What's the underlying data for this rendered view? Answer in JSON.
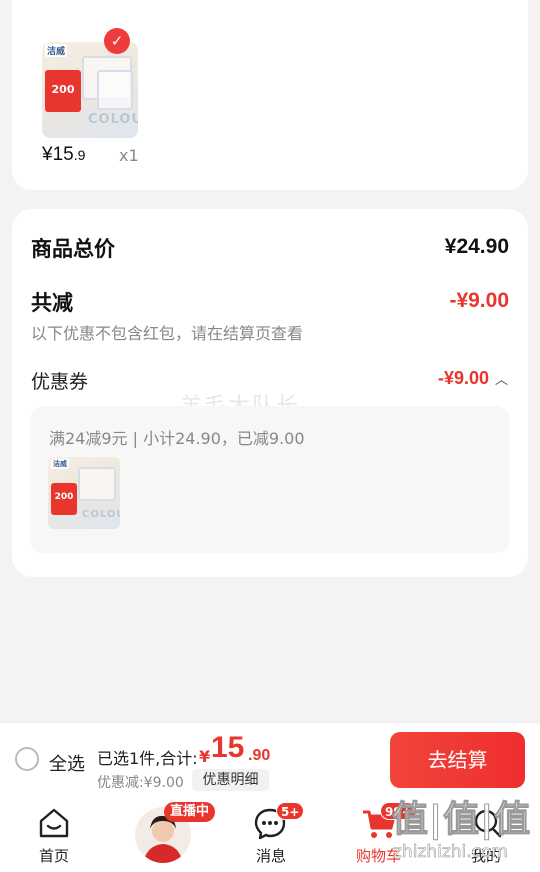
{
  "item": {
    "brand": "洁威",
    "promo_tag": "200",
    "box_word": "COLOUR",
    "price_int": "¥15",
    "price_dec": ".9",
    "quantity": "x1"
  },
  "summary": {
    "total_label": "商品总价",
    "total_value": "¥24.90",
    "reduce_label": "共减",
    "reduce_value": "-¥9.00",
    "note": "以下优惠不包含红包，请在结算页查看",
    "coupon_label": "优惠券",
    "coupon_value": "-¥9.00",
    "coupon_rule": "满24减9元 | 小计24.90，已减9.00",
    "watermark": "羊毛大队长"
  },
  "checkout_bar": {
    "select_all": "全选",
    "selected_text": "已选1件,合计:",
    "total_yen": "¥",
    "total_int": "15",
    "total_dec": ".90",
    "discount_text": "优惠减:¥9.00",
    "detail_button": "优惠明细",
    "checkout_button": "去结算"
  },
  "tabbar": {
    "home": "首页",
    "live_badge": "直播中",
    "messages": "消息",
    "messages_badge": "5+",
    "cart": "购物车",
    "cart_badge": "99+",
    "mine": "我的"
  },
  "colors": {
    "accent": "#e8352d",
    "background": "#f3f3f3"
  },
  "site_watermark": {
    "title": "值|值|值",
    "url": "zhizhizhi.com"
  }
}
